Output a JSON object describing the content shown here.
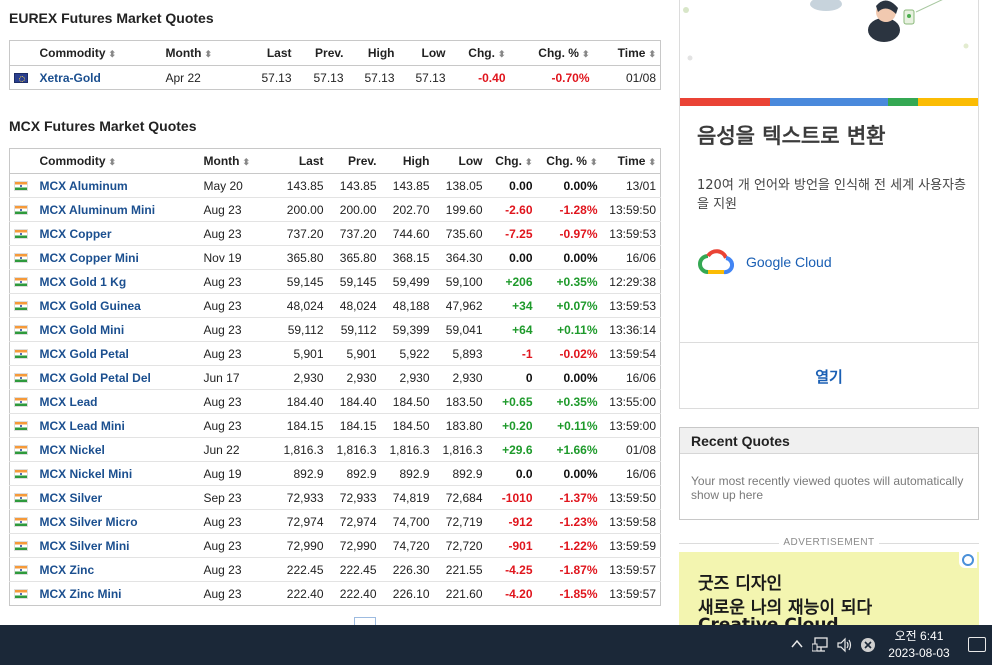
{
  "eurex": {
    "title": "EUREX Futures Market Quotes",
    "headers": {
      "commodity": "Commodity",
      "month": "Month",
      "last": "Last",
      "prev": "Prev.",
      "high": "High",
      "low": "Low",
      "chg": "Chg.",
      "chg_pct": "Chg. %",
      "time": "Time"
    },
    "sort_glyph": "⬍",
    "rows": [
      {
        "name": "Xetra-Gold",
        "flag": "eu-flag",
        "month": "Apr 22",
        "last": "57.13",
        "prev": "57.13",
        "high": "57.13",
        "low": "57.13",
        "chg": "-0.40",
        "chg_pct": "-0.70%",
        "time": "01/08",
        "dir": "neg"
      }
    ]
  },
  "mcx": {
    "title": "MCX Futures Market Quotes",
    "headers": {
      "commodity": "Commodity",
      "month": "Month",
      "last": "Last",
      "prev": "Prev.",
      "high": "High",
      "low": "Low",
      "chg": "Chg.",
      "chg_pct": "Chg. %",
      "time": "Time"
    },
    "rows": [
      {
        "name": "MCX Aluminum",
        "month": "May 20",
        "last": "143.85",
        "prev": "143.85",
        "high": "143.85",
        "low": "138.05",
        "chg": "0.00",
        "chg_pct": "0.00%",
        "time": "13/01",
        "dir": "zero"
      },
      {
        "name": "MCX Aluminum Mini",
        "month": "Aug 23",
        "last": "200.00",
        "prev": "200.00",
        "high": "202.70",
        "low": "199.60",
        "chg": "-2.60",
        "chg_pct": "-1.28%",
        "time": "13:59:50",
        "dir": "neg"
      },
      {
        "name": "MCX Copper",
        "month": "Aug 23",
        "last": "737.20",
        "prev": "737.20",
        "high": "744.60",
        "low": "735.60",
        "chg": "-7.25",
        "chg_pct": "-0.97%",
        "time": "13:59:53",
        "dir": "neg"
      },
      {
        "name": "MCX Copper Mini",
        "month": "Nov 19",
        "last": "365.80",
        "prev": "365.80",
        "high": "368.15",
        "low": "364.30",
        "chg": "0.00",
        "chg_pct": "0.00%",
        "time": "16/06",
        "dir": "zero"
      },
      {
        "name": "MCX Gold 1 Kg",
        "month": "Aug 23",
        "last": "59,145",
        "prev": "59,145",
        "high": "59,499",
        "low": "59,100",
        "chg": "+206",
        "chg_pct": "+0.35%",
        "time": "12:29:38",
        "dir": "pos"
      },
      {
        "name": "MCX Gold Guinea",
        "month": "Aug 23",
        "last": "48,024",
        "prev": "48,024",
        "high": "48,188",
        "low": "47,962",
        "chg": "+34",
        "chg_pct": "+0.07%",
        "time": "13:59:53",
        "dir": "pos"
      },
      {
        "name": "MCX Gold Mini",
        "month": "Aug 23",
        "last": "59,112",
        "prev": "59,112",
        "high": "59,399",
        "low": "59,041",
        "chg": "+64",
        "chg_pct": "+0.11%",
        "time": "13:36:14",
        "dir": "pos"
      },
      {
        "name": "MCX Gold Petal",
        "month": "Aug 23",
        "last": "5,901",
        "prev": "5,901",
        "high": "5,922",
        "low": "5,893",
        "chg": "-1",
        "chg_pct": "-0.02%",
        "time": "13:59:54",
        "dir": "neg"
      },
      {
        "name": "MCX Gold Petal Del",
        "month": "Jun 17",
        "last": "2,930",
        "prev": "2,930",
        "high": "2,930",
        "low": "2,930",
        "chg": "0",
        "chg_pct": "0.00%",
        "time": "16/06",
        "dir": "zero"
      },
      {
        "name": "MCX Lead",
        "month": "Aug 23",
        "last": "184.40",
        "prev": "184.40",
        "high": "184.50",
        "low": "183.50",
        "chg": "+0.65",
        "chg_pct": "+0.35%",
        "time": "13:55:00",
        "dir": "pos"
      },
      {
        "name": "MCX Lead Mini",
        "month": "Aug 23",
        "last": "184.15",
        "prev": "184.15",
        "high": "184.50",
        "low": "183.80",
        "chg": "+0.20",
        "chg_pct": "+0.11%",
        "time": "13:59:00",
        "dir": "pos"
      },
      {
        "name": "MCX Nickel",
        "month": "Jun 22",
        "last": "1,816.3",
        "prev": "1,816.3",
        "high": "1,816.3",
        "low": "1,816.3",
        "chg": "+29.6",
        "chg_pct": "+1.66%",
        "time": "01/08",
        "dir": "pos"
      },
      {
        "name": "MCX Nickel Mini",
        "month": "Aug 19",
        "last": "892.9",
        "prev": "892.9",
        "high": "892.9",
        "low": "892.9",
        "chg": "0.0",
        "chg_pct": "0.00%",
        "time": "16/06",
        "dir": "zero"
      },
      {
        "name": "MCX Silver",
        "month": "Sep 23",
        "last": "72,933",
        "prev": "72,933",
        "high": "74,819",
        "low": "72,684",
        "chg": "-1010",
        "chg_pct": "-1.37%",
        "time": "13:59:50",
        "dir": "neg"
      },
      {
        "name": "MCX Silver Micro",
        "month": "Aug 23",
        "last": "72,974",
        "prev": "72,974",
        "high": "74,700",
        "low": "72,719",
        "chg": "-912",
        "chg_pct": "-1.23%",
        "time": "13:59:58",
        "dir": "neg"
      },
      {
        "name": "MCX Silver Mini",
        "month": "Aug 23",
        "last": "72,990",
        "prev": "72,990",
        "high": "74,720",
        "low": "72,720",
        "chg": "-901",
        "chg_pct": "-1.22%",
        "time": "13:59:59",
        "dir": "neg"
      },
      {
        "name": "MCX Zinc",
        "month": "Aug 23",
        "last": "222.45",
        "prev": "222.45",
        "high": "226.30",
        "low": "221.55",
        "chg": "-4.25",
        "chg_pct": "-1.87%",
        "time": "13:59:57",
        "dir": "neg"
      },
      {
        "name": "MCX Zinc Mini",
        "month": "Aug 23",
        "last": "222.40",
        "prev": "222.40",
        "high": "226.10",
        "low": "221.60",
        "chg": "-4.20",
        "chg_pct": "-1.85%",
        "time": "13:59:57",
        "dir": "neg"
      }
    ],
    "row_flag": "india-flag"
  },
  "sidebar": {
    "ad_top": {
      "title": "음성을 텍스트로 변환",
      "description": "120여 개 언어와 방언을 인식해 전 세계 사용자층을 지원",
      "brand": "Google Cloud",
      "brand_icon": "google-cloud-icon",
      "cta": "열기",
      "bar_colors": [
        "#ea4335",
        "#4a89dc",
        "#34a853",
        "#fbbc04"
      ]
    },
    "recent_quotes": {
      "title": "Recent Quotes",
      "body": "Your most recently viewed quotes will automatically show up here"
    },
    "advertisement_label": "ADVERTISEMENT",
    "ad_bottom": {
      "line1": "굿즈 디자인",
      "line2": "새로운 나의 재능이 되다",
      "line3": "Creative Cloud",
      "background": "#f3f5b0"
    }
  },
  "taskbar": {
    "time": "오전 6:41",
    "date": "2023-08-03",
    "icons": [
      "chevron-up-icon",
      "network-icon",
      "volume-icon",
      "close-circle-icon",
      "notification-icon"
    ]
  },
  "colors": {
    "positive": "#1e9a2b",
    "negative": "#e0151d",
    "link": "#1b4f8f"
  }
}
